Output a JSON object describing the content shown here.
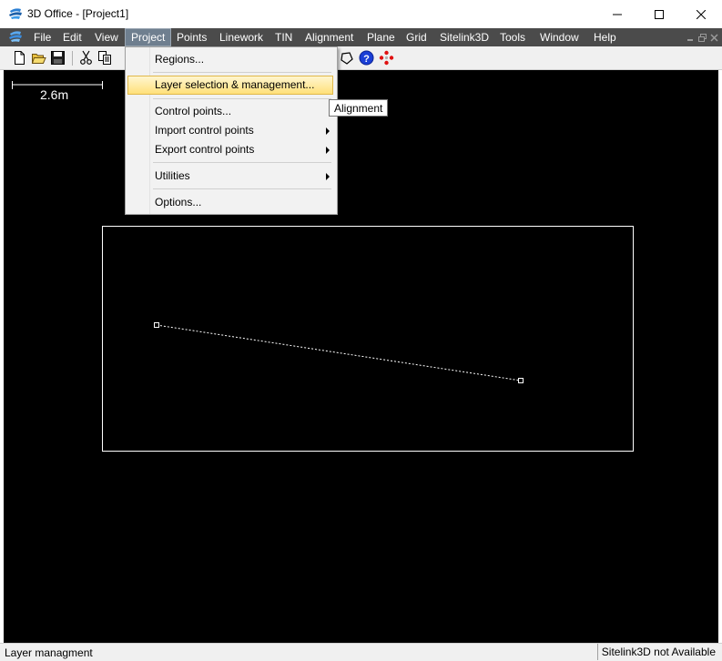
{
  "window": {
    "title": "3D Office - [Project1]"
  },
  "menubar": {
    "items": [
      "File",
      "Edit",
      "View",
      "Project",
      "Points",
      "Linework",
      "TIN",
      "Alignment",
      "Plane",
      "Grid",
      "Sitelink3D",
      "Tools",
      "Window",
      "Help"
    ],
    "active": "Project"
  },
  "toolbar": {
    "icons": [
      "new-file-icon",
      "open-folder-icon",
      "save-icon",
      "cut-icon",
      "copy-icon",
      "polygon-icon",
      "help-icon",
      "snap-points-icon"
    ]
  },
  "canvas": {
    "scale_label": "2.6m",
    "background": "#000000",
    "line_color": "#ffffff"
  },
  "project_menu": {
    "items": [
      {
        "label": "Regions..."
      },
      {
        "label": "Layer selection & management..."
      },
      {
        "label": "Control points..."
      },
      {
        "label": "Import control points"
      },
      {
        "label": "Export control points"
      },
      {
        "label": "Utilities"
      },
      {
        "label": "Options..."
      }
    ],
    "highlighted": "Layer selection & management..."
  },
  "tooltip": {
    "text": "Alignment"
  },
  "statusbar": {
    "left": "Layer managment",
    "right": "Sitelink3D not Available"
  },
  "colors": {
    "menubar": "#4b4b4b",
    "highlight": "#ffe07a"
  }
}
